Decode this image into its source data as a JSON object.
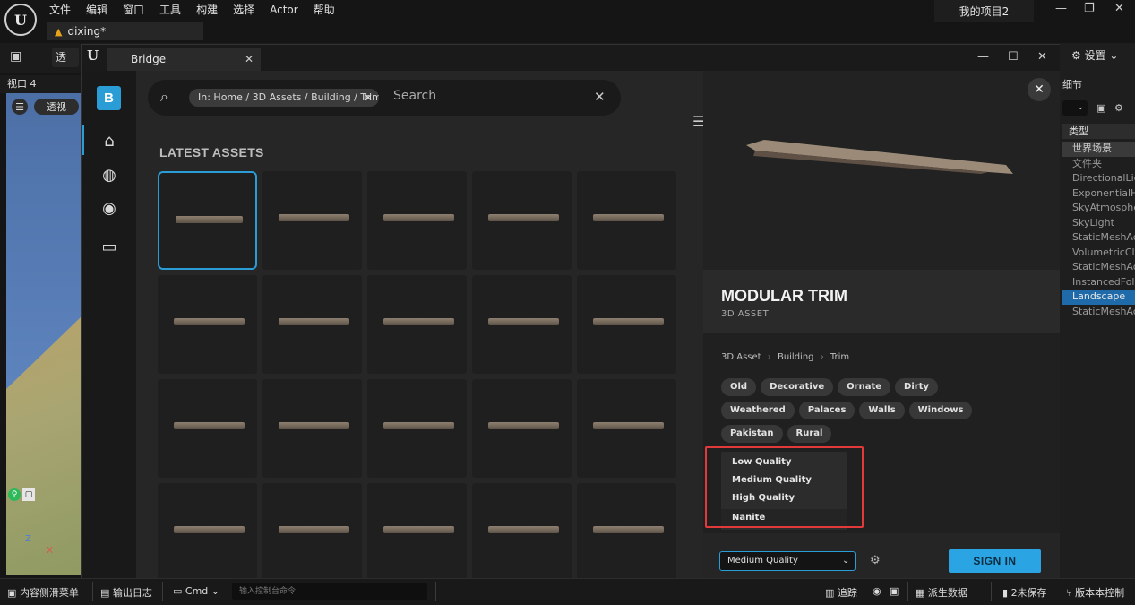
{
  "menubar": {
    "items": [
      "文件",
      "编辑",
      "窗口",
      "工具",
      "构建",
      "选择",
      "Actor",
      "帮助"
    ],
    "project": "我的项目2"
  },
  "doc_tab": {
    "label": "dixing*"
  },
  "toolbar": {
    "persp_btn": "透"
  },
  "viewport": {
    "title": "视口 4",
    "persp_label": "透视",
    "axis_z": "Z",
    "axis_x": "X"
  },
  "bridge": {
    "tab_title": "Bridge",
    "sidebar_logo": "B",
    "search": {
      "chip": "In: Home / 3D Assets / Building / Trim",
      "placeholder": "Search"
    },
    "section_title": "LATEST ASSETS",
    "tile_count": 20,
    "asset": {
      "name": "MODULAR TRIM",
      "type": "3D ASSET"
    },
    "breadcrumb": [
      "3D Asset",
      "Building",
      "Trim"
    ],
    "tags": [
      "Old",
      "Decorative",
      "Ornate",
      "Dirty",
      "Weathered",
      "Palaces",
      "Walls",
      "Windows",
      "Pakistan",
      "Rural"
    ],
    "quality_options": [
      "Low Quality",
      "Medium Quality",
      "High Quality",
      "Nanite"
    ],
    "selected_quality": "Medium Quality",
    "sign_in": "SIGN IN",
    "accent": "#2a9cd6"
  },
  "details_panel": {
    "settings": "设置",
    "title": "细节",
    "header": "类型",
    "outliner": [
      "世界场景",
      "文件夹",
      "DirectionalLig",
      "ExponentialH",
      "SkyAtmosphe",
      "SkyLight",
      "StaticMeshAc",
      "VolumetricCl",
      "StaticMeshAc",
      "InstancedFoli",
      "Landscape",
      "StaticMeshAc"
    ]
  },
  "statusbar": {
    "content_drawer": "内容侧滑菜单",
    "output_log": "输出日志",
    "cmd": "Cmd",
    "cmd_placeholder": "输入控制台命令",
    "trace": "追踪",
    "derived_data": "派生数据",
    "unsaved": "2未保存",
    "source_control": "版本本控制"
  }
}
